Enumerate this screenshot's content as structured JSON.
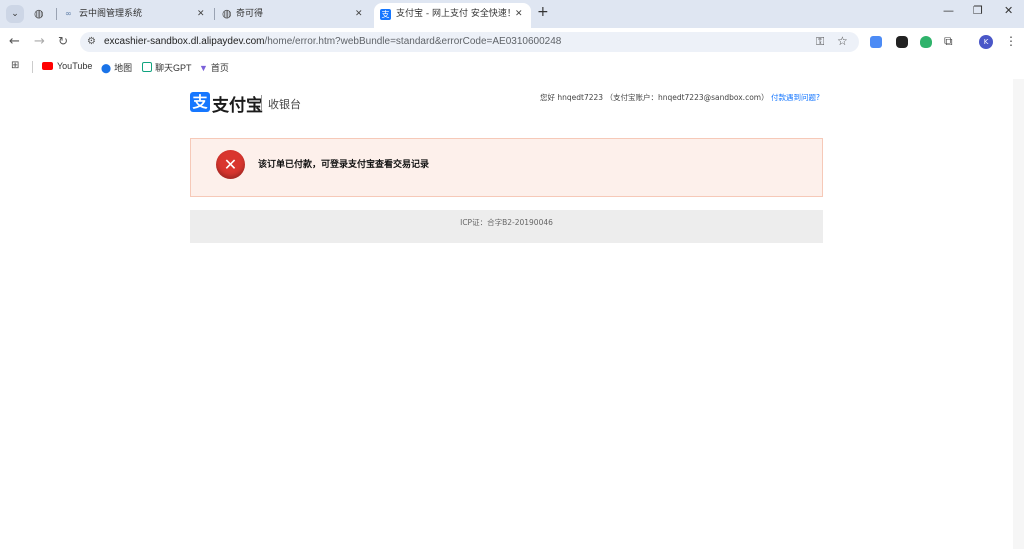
{
  "browser": {
    "tabs": [
      {
        "title": "云中阁管理系统",
        "active": false
      },
      {
        "title": "奇可得",
        "active": false
      },
      {
        "title": "支付宝 - 网上支付 安全快速！",
        "active": true
      }
    ],
    "close_glyph": "✕",
    "new_tab_glyph": "+",
    "window_controls": [
      "—",
      "❐",
      "✕"
    ],
    "url_host": "excashier-sandbox.dl.alipaydev.com",
    "url_rest": "/home/error.htm?webBundle=standard&errorCode=AE0310600248",
    "bookmarks": [
      {
        "label": "YouTube",
        "icon": "youtube-icon"
      },
      {
        "label": "地图",
        "icon": "maps-icon"
      },
      {
        "label": "聊天GPT",
        "icon": "chatgpt-icon"
      },
      {
        "label": "首页",
        "icon": "vuetify-icon"
      }
    ],
    "profile_initial": "K",
    "accent": "#1677ff"
  },
  "page": {
    "logo_mark": "支",
    "logo_text": "支付宝",
    "logo_sub": "收银台",
    "greeting": "您好 hnqedt7223 （支付宝账户：hnqedt7223@sandbox.com）",
    "help_link": "付款遇到问题?",
    "error_message": "该订单已付款，可登录支付宝查看交易记录",
    "error_glyph": "✕",
    "icp": "ICP证：合字B2-20190046"
  }
}
